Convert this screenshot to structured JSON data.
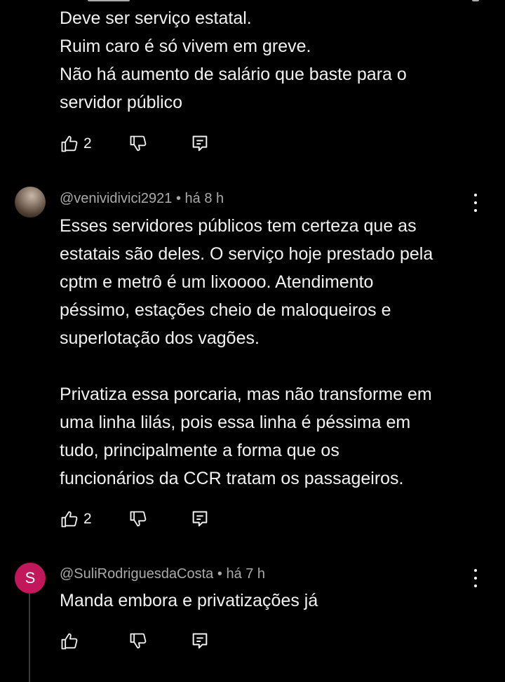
{
  "comments": [
    {
      "author": "",
      "time": "",
      "text_lines": [
        "Deve ser serviço estatal.",
        "Ruim caro  é só vivem em greve.",
        "Não há aumento de salário que baste para o",
        "servidor público"
      ],
      "likes": "2"
    },
    {
      "author": "@venividivici2921",
      "separator": "•",
      "time": "há 8 h",
      "paragraph1": [
        "Esses servidores públicos tem certeza que as",
        "estatais são deles. O serviço hoje prestado pela",
        "cptm e metrô é um lixoooo. Atendimento",
        "péssimo, estações cheio de maloqueiros e",
        "superlotação dos vagões."
      ],
      "paragraph2": [
        "Privatiza essa porcaria, mas não transforme em",
        "uma linha lilás, pois essa linha é péssima em",
        "tudo, principalmente a forma que os",
        "funcionários da CCR tratam os passageiros."
      ],
      "likes": "2"
    },
    {
      "author": "@SuliRodriguesdaCosta",
      "separator": "•",
      "time": "há 7 h",
      "avatar_letter": "S",
      "text_lines": [
        "Manda embora e privatizações já"
      ],
      "likes": ""
    }
  ],
  "icons": {
    "like": "thumb-up-icon",
    "dislike": "thumb-down-icon",
    "reply": "reply-icon",
    "menu": "more-vert-icon"
  },
  "colors": {
    "background": "#000000",
    "text": "#f1f1f1",
    "meta": "#aaaaaa",
    "avatar_accent": "#c2185b"
  }
}
